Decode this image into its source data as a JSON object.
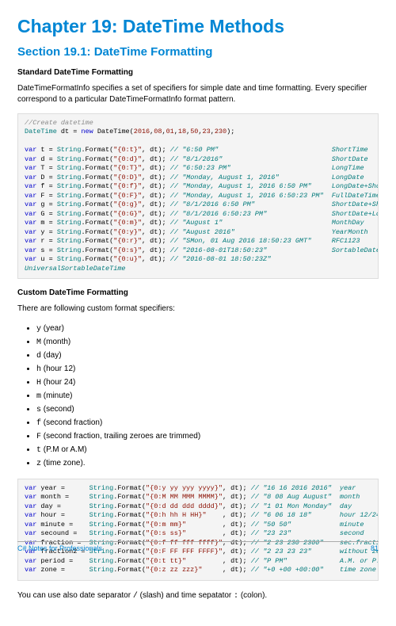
{
  "header": {
    "chapter_title": "Chapter 19: DateTime Methods",
    "section_title": "Section 19.1: DateTime Formatting"
  },
  "std": {
    "heading": "Standard DateTime Formatting",
    "intro": "DateTimeFormatInfo specifies a set of specifiers for simple date and time formatting. Every specifier correspond to a particular DateTimeFormatInfo format pattern.",
    "c0": "//Create datetime",
    "c1a": "DateTime",
    "c1b": " dt = ",
    "c1c": "new",
    "c1d": " DateTime(",
    "c1e": "2016",
    "c1f": ",",
    "c1g": "08",
    "c1h": ",",
    "c1i": "01",
    "c1j": ",",
    "c1k": "18",
    "c1l": ",",
    "c1m": "50",
    "c1n": ",",
    "c1o": "23",
    "c1p": ",",
    "c1q": "230",
    "c1r": ");",
    "rows": [
      {
        "v": "t",
        "fmt": "\"{0:t}\"",
        "out": "// \"6:50 PM\"",
        "lbl": "ShortTime"
      },
      {
        "v": "d",
        "fmt": "\"{0:d}\"",
        "out": "// \"8/1/2016\"",
        "lbl": "ShortDate"
      },
      {
        "v": "T",
        "fmt": "\"{0:T}\"",
        "out": "// \"6:50:23 PM\"",
        "lbl": "LongTime"
      },
      {
        "v": "D",
        "fmt": "\"{0:D}\"",
        "out": "// \"Monday, August 1, 2016\"",
        "lbl": "LongDate"
      },
      {
        "v": "f",
        "fmt": "\"{0:f}\"",
        "out": "// \"Monday, August 1, 2016 6:50 PM\"",
        "lbl": "LongDate+ShortTime"
      },
      {
        "v": "F",
        "fmt": "\"{0:F}\"",
        "out": "// \"Monday, August 1, 2016 6:50:23 PM\"",
        "lbl": "FullDateTime"
      },
      {
        "v": "g",
        "fmt": "\"{0:g}\"",
        "out": "// \"8/1/2016 6:50 PM\"",
        "lbl": "ShortDate+ShortTime"
      },
      {
        "v": "G",
        "fmt": "\"{0:G}\"",
        "out": "// \"8/1/2016 6:50:23 PM\"",
        "lbl": "ShortDate+LongTime"
      },
      {
        "v": "m",
        "fmt": "\"{0:m}\"",
        "out": "// \"August 1\"",
        "lbl": "MonthDay"
      },
      {
        "v": "y",
        "fmt": "\"{0:y}\"",
        "out": "// \"August 2016\"",
        "lbl": "YearMonth"
      },
      {
        "v": "r",
        "fmt": "\"{0:r}\"",
        "out": "// \"SMon, 01 Aug 2016 18:50:23 GMT\"",
        "lbl": "RFC1123"
      },
      {
        "v": "s",
        "fmt": "\"{0:s}\"",
        "out": "// \"2016-08-01T18:50:23\"",
        "lbl": "SortableDateTime"
      },
      {
        "v": "u",
        "fmt": "\"{0:u}\"",
        "out": "// \"2016-08-01 18:50:23Z\"",
        "lbl": ""
      }
    ],
    "last_label": "UniversalSortableDateTime"
  },
  "cust": {
    "heading": "Custom DateTime Formatting",
    "intro": "There are following custom format specifiers:",
    "list": [
      {
        "code": "y",
        "tail": " (year)"
      },
      {
        "code": "M",
        "tail": " (month)"
      },
      {
        "code": "d",
        "tail": " (day)"
      },
      {
        "code": "h",
        "tail": " (hour 12)"
      },
      {
        "code": "H",
        "tail": " (hour 24)"
      },
      {
        "code": "m",
        "tail": " (minute)"
      },
      {
        "code": "s",
        "tail": " (second)"
      },
      {
        "code": "f",
        "tail": " (second fraction)"
      },
      {
        "code": "F",
        "tail": " (second fraction, trailing zeroes are trimmed)"
      },
      {
        "code": "t",
        "tail": " (P.M or A.M)"
      },
      {
        "code": "z",
        "tail": " (time zone)."
      }
    ],
    "rows": [
      {
        "v": "year =     ",
        "fmt": "\"{0:y yy yyy yyyy}\"",
        "out": "// \"16 16 2016 2016\"",
        "lbl": "year"
      },
      {
        "v": "month =    ",
        "fmt": "\"{0:M MM MMM MMMM}\"",
        "out": "// \"8 08 Aug August\"",
        "lbl": "month"
      },
      {
        "v": "day =      ",
        "fmt": "\"{0:d dd ddd dddd}\"",
        "out": "// \"1 01 Mon Monday\"",
        "lbl": "day"
      },
      {
        "v": "hour =     ",
        "fmt": "\"{0:h hh H HH}\"    ",
        "out": "// \"6 06 18 18\"     ",
        "lbl": "hour 12/24"
      },
      {
        "v": "minute =   ",
        "fmt": "\"{0:m mm}\"         ",
        "out": "// \"50 50\"          ",
        "lbl": "minute"
      },
      {
        "v": "secound =  ",
        "fmt": "\"{0:s ss}\"         ",
        "out": "// \"23 23\"          ",
        "lbl": "second"
      },
      {
        "v": "fraction = ",
        "fmt": "\"{0:f ff fff ffff}\"",
        "out": "// \"2 23 230 2300\"  ",
        "lbl": "sec.fraction"
      },
      {
        "v": "fraction2 =",
        "fmt": "\"{0:F FF FFF FFFF}\"",
        "out": "// \"2 23 23 23\"     ",
        "lbl": "without zeroes"
      },
      {
        "v": "period =   ",
        "fmt": "\"{0:t tt}\"         ",
        "out": "// \"P PM\"           ",
        "lbl": "A.M. or P.M."
      },
      {
        "v": "zone =     ",
        "fmt": "\"{0:z zz zzz}\"     ",
        "out": "// \"+0 +00 +00:00\"  ",
        "lbl": "time zone"
      }
    ],
    "footer_text_a": "You can use also date separator ",
    "footer_text_b": " (slash) and time sepatator ",
    "footer_text_c": " (colon).",
    "slash": "/",
    "colon": ":"
  },
  "footer": {
    "left": "C# Notes for Professionals",
    "right": "81"
  }
}
